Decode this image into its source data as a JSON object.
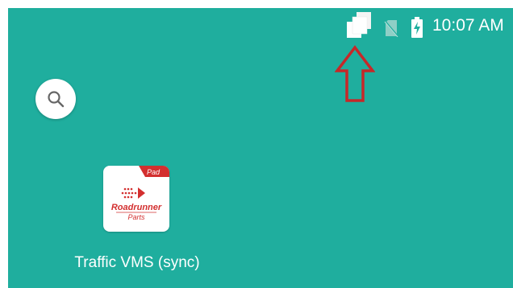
{
  "status_bar": {
    "time": "10:07 AM",
    "icons": [
      "sync-notification-icon",
      "no-sim-icon",
      "battery-charging-icon"
    ]
  },
  "search": {
    "icon": "search-icon"
  },
  "home": {
    "apps": [
      {
        "label": "Traffic VMS (sync)",
        "icon_badge": "Pad",
        "icon_logo_line1": "Roadrunner",
        "icon_logo_line2": "Parts"
      }
    ]
  },
  "colors": {
    "wallpaper": "#1fae9e",
    "annotation_arrow": "#c62828",
    "logo_red": "#d32f2f"
  }
}
